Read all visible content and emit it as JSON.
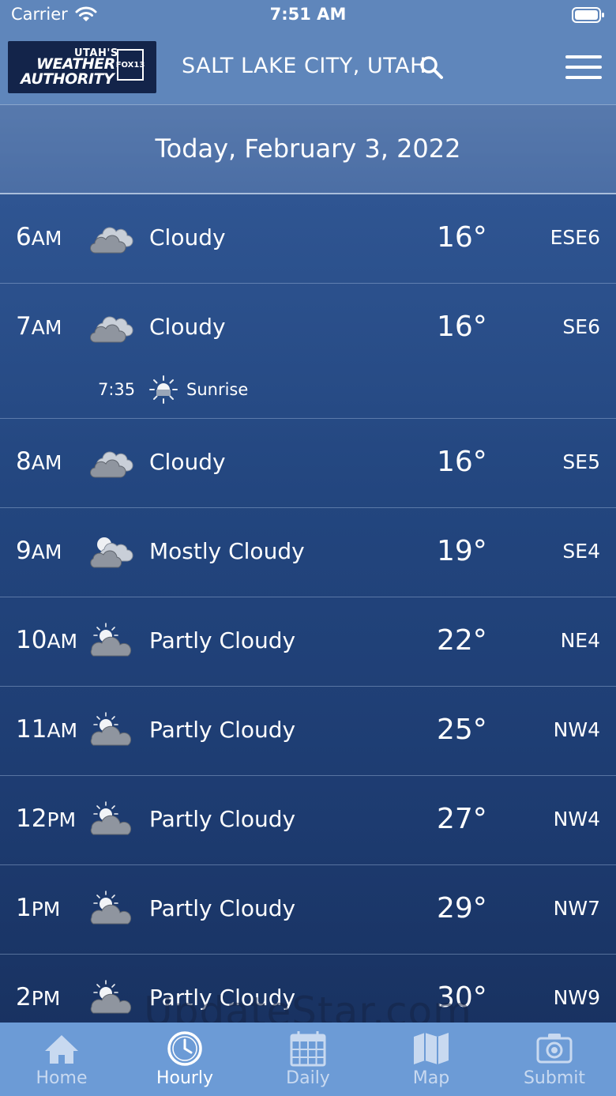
{
  "status_bar": {
    "carrier": "Carrier",
    "time": "7:51 AM"
  },
  "header": {
    "logo": {
      "line1": "UTAH'S",
      "line2": "WEATHER",
      "line3": "AUTHORITY",
      "badge": "FOX13"
    },
    "city": "SALT LAKE CITY, UTAH"
  },
  "date_label": "Today, February 3, 2022",
  "hours": [
    {
      "hour": "6",
      "ampm": "AM",
      "icon": "cloudy-icon",
      "condition": "Cloudy",
      "temp": "16°",
      "wind": "ESE6"
    },
    {
      "hour": "7",
      "ampm": "AM",
      "icon": "cloudy-icon",
      "condition": "Cloudy",
      "temp": "16°",
      "wind": "SE6",
      "event": {
        "time": "7:35",
        "label": "Sunrise",
        "icon": "sunrise-icon"
      }
    },
    {
      "hour": "8",
      "ampm": "AM",
      "icon": "cloudy-icon",
      "condition": "Cloudy",
      "temp": "16°",
      "wind": "SE5"
    },
    {
      "hour": "9",
      "ampm": "AM",
      "icon": "mostly-cloudy-icon",
      "condition": "Mostly Cloudy",
      "temp": "19°",
      "wind": "SE4"
    },
    {
      "hour": "10",
      "ampm": "AM",
      "icon": "partly-cloudy-icon",
      "condition": "Partly Cloudy",
      "temp": "22°",
      "wind": "NE4"
    },
    {
      "hour": "11",
      "ampm": "AM",
      "icon": "partly-cloudy-icon",
      "condition": "Partly Cloudy",
      "temp": "25°",
      "wind": "NW4"
    },
    {
      "hour": "12",
      "ampm": "PM",
      "icon": "partly-cloudy-icon",
      "condition": "Partly Cloudy",
      "temp": "27°",
      "wind": "NW4"
    },
    {
      "hour": "1",
      "ampm": "PM",
      "icon": "partly-cloudy-icon",
      "condition": "Partly Cloudy",
      "temp": "29°",
      "wind": "NW7"
    },
    {
      "hour": "2",
      "ampm": "PM",
      "icon": "partly-cloudy-icon",
      "condition": "Partly Cloudy",
      "temp": "30°",
      "wind": "NW9"
    }
  ],
  "tabs": [
    {
      "label": "Home",
      "icon": "home-icon"
    },
    {
      "label": "Hourly",
      "icon": "clock-icon",
      "active": true
    },
    {
      "label": "Daily",
      "icon": "calendar-icon"
    },
    {
      "label": "Map",
      "icon": "map-icon"
    },
    {
      "label": "Submit",
      "icon": "camera-icon"
    }
  ],
  "watermark": "UpdateStar.com"
}
